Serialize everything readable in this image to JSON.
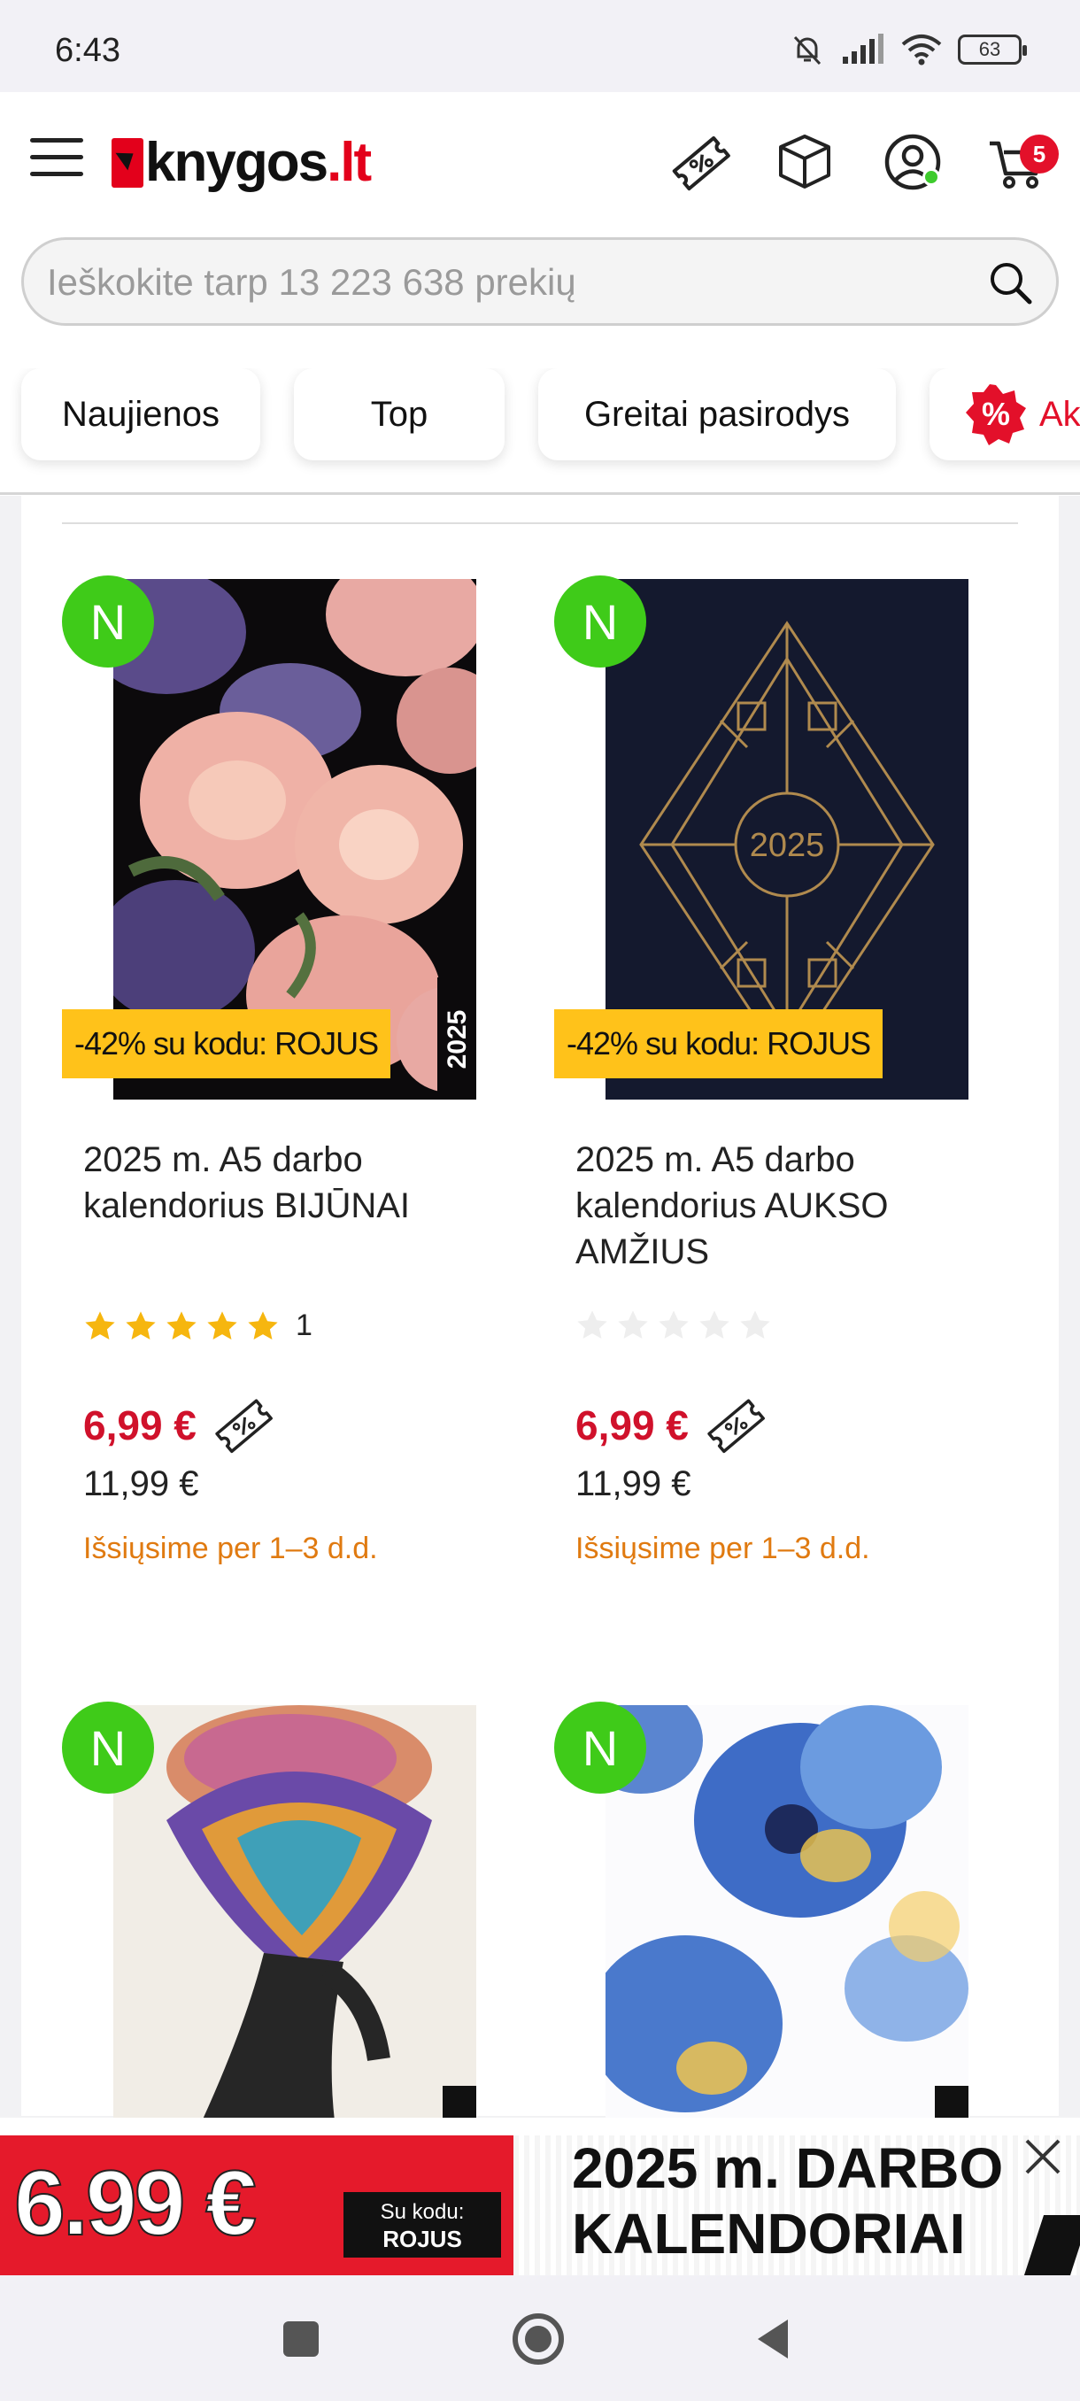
{
  "status_bar": {
    "time": "6:43",
    "battery": "63"
  },
  "header": {
    "logo_main": "knygos",
    "logo_tld": ".lt",
    "cart_count": "5",
    "icons": [
      "menu-icon",
      "coupon-icon",
      "box-icon",
      "user-icon",
      "cart-icon"
    ]
  },
  "search": {
    "placeholder": "Ieškokite tarp 13 223 638 prekių"
  },
  "categories": [
    {
      "label": "Naujienos"
    },
    {
      "label": "Top"
    },
    {
      "label": "Greitai pasirodys"
    },
    {
      "label": "Ak"
    }
  ],
  "products": [
    {
      "badge": "N",
      "promo": "-42% su kodu: ROJUS",
      "title": "2025 m. A5 darbo kalendorius BIJŪNAI",
      "rating": 5,
      "rating_count": "1",
      "price": "6,99 €",
      "old_price": "11,99 €",
      "shipping": "Išsiųsime per 1–3 d.d.",
      "cover_text": "2025"
    },
    {
      "badge": "N",
      "promo": "-42% su kodu: ROJUS",
      "title": "2025 m. A5 darbo kalendorius AUKSO AMŽIUS",
      "rating": 0,
      "rating_count": "",
      "price": "6,99 €",
      "old_price": "11,99 €",
      "shipping": "Išsiųsime per 1–3 d.d.",
      "cover_text": "2025"
    },
    {
      "badge": "N"
    },
    {
      "badge": "N"
    }
  ],
  "banner": {
    "price": "6.99 €",
    "code_label": "Su kodu:",
    "code": "ROJUS",
    "title_line1": "2025 m. DARBO",
    "title_line2": "KALENDORIAI"
  },
  "colors": {
    "brand_red": "#e3001b",
    "new_green": "#3fcb19",
    "promo_yellow": "#ffc21a",
    "price_red": "#d0112b",
    "shipping_orange": "#e07a10",
    "star_gold": "#f6b60f"
  }
}
